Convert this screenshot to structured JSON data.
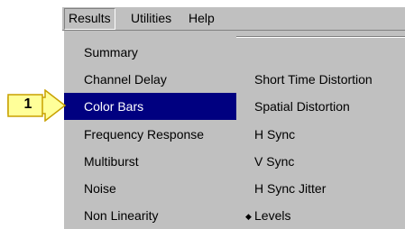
{
  "menubar": {
    "items": [
      "Results",
      "Utilities",
      "Help"
    ]
  },
  "results_menu": {
    "left_items": [
      "Summary",
      "Channel Delay",
      "Color Bars",
      "Frequency Response",
      "Multiburst",
      "Noise",
      "Non Linearity"
    ],
    "selected_item": "Color Bars",
    "right_items": [
      "Short Time Distortion",
      "Spatial Distortion",
      "H Sync",
      "V Sync",
      "H Sync Jitter",
      "Levels"
    ],
    "checked_item": "Levels",
    "bullet": "◆"
  },
  "callout": {
    "label": "1"
  },
  "colors": {
    "menu_bg": "#c0c0c0",
    "selection_bg": "#000080",
    "selection_fg": "#ffffff",
    "callout_fill": "#ffff99",
    "callout_border": "#c8a000"
  }
}
